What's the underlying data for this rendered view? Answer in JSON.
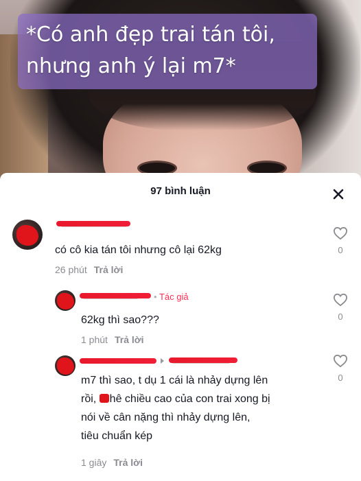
{
  "video": {
    "caption": "*Có anh đẹp trai tán tôi, nhưng anh ý lại m7*"
  },
  "comments_panel": {
    "count_label": "97 bình luận",
    "close_icon": "close-icon"
  },
  "comments": [
    {
      "text": "có cô kia tán tôi nhưng cô lại 62kg",
      "time": "26 phút",
      "reply_label": "Trả lời",
      "likes": "0"
    },
    {
      "author_tag": "Tác giả",
      "text": "62kg thì sao???",
      "time": "1 phút",
      "reply_label": "Trả lời",
      "likes": "0"
    },
    {
      "text_line1": "m7 thì sao, t dụ 1 cái là nhảy dựng lên",
      "text_line2_a": "rồi, ",
      "text_line2_b": "hê chiều cao của con trai xong bị",
      "text_line3": "nói về cân nặng thì nhảy dựng lên,",
      "text_line4": "tiêu chuẩn kép",
      "time": "1 giây",
      "reply_label": "Trả lời",
      "likes": "0"
    }
  ],
  "colors": {
    "accent": "#fe2c55",
    "redaction": "#e0151b",
    "caption_bg": "#8c6ec8"
  }
}
